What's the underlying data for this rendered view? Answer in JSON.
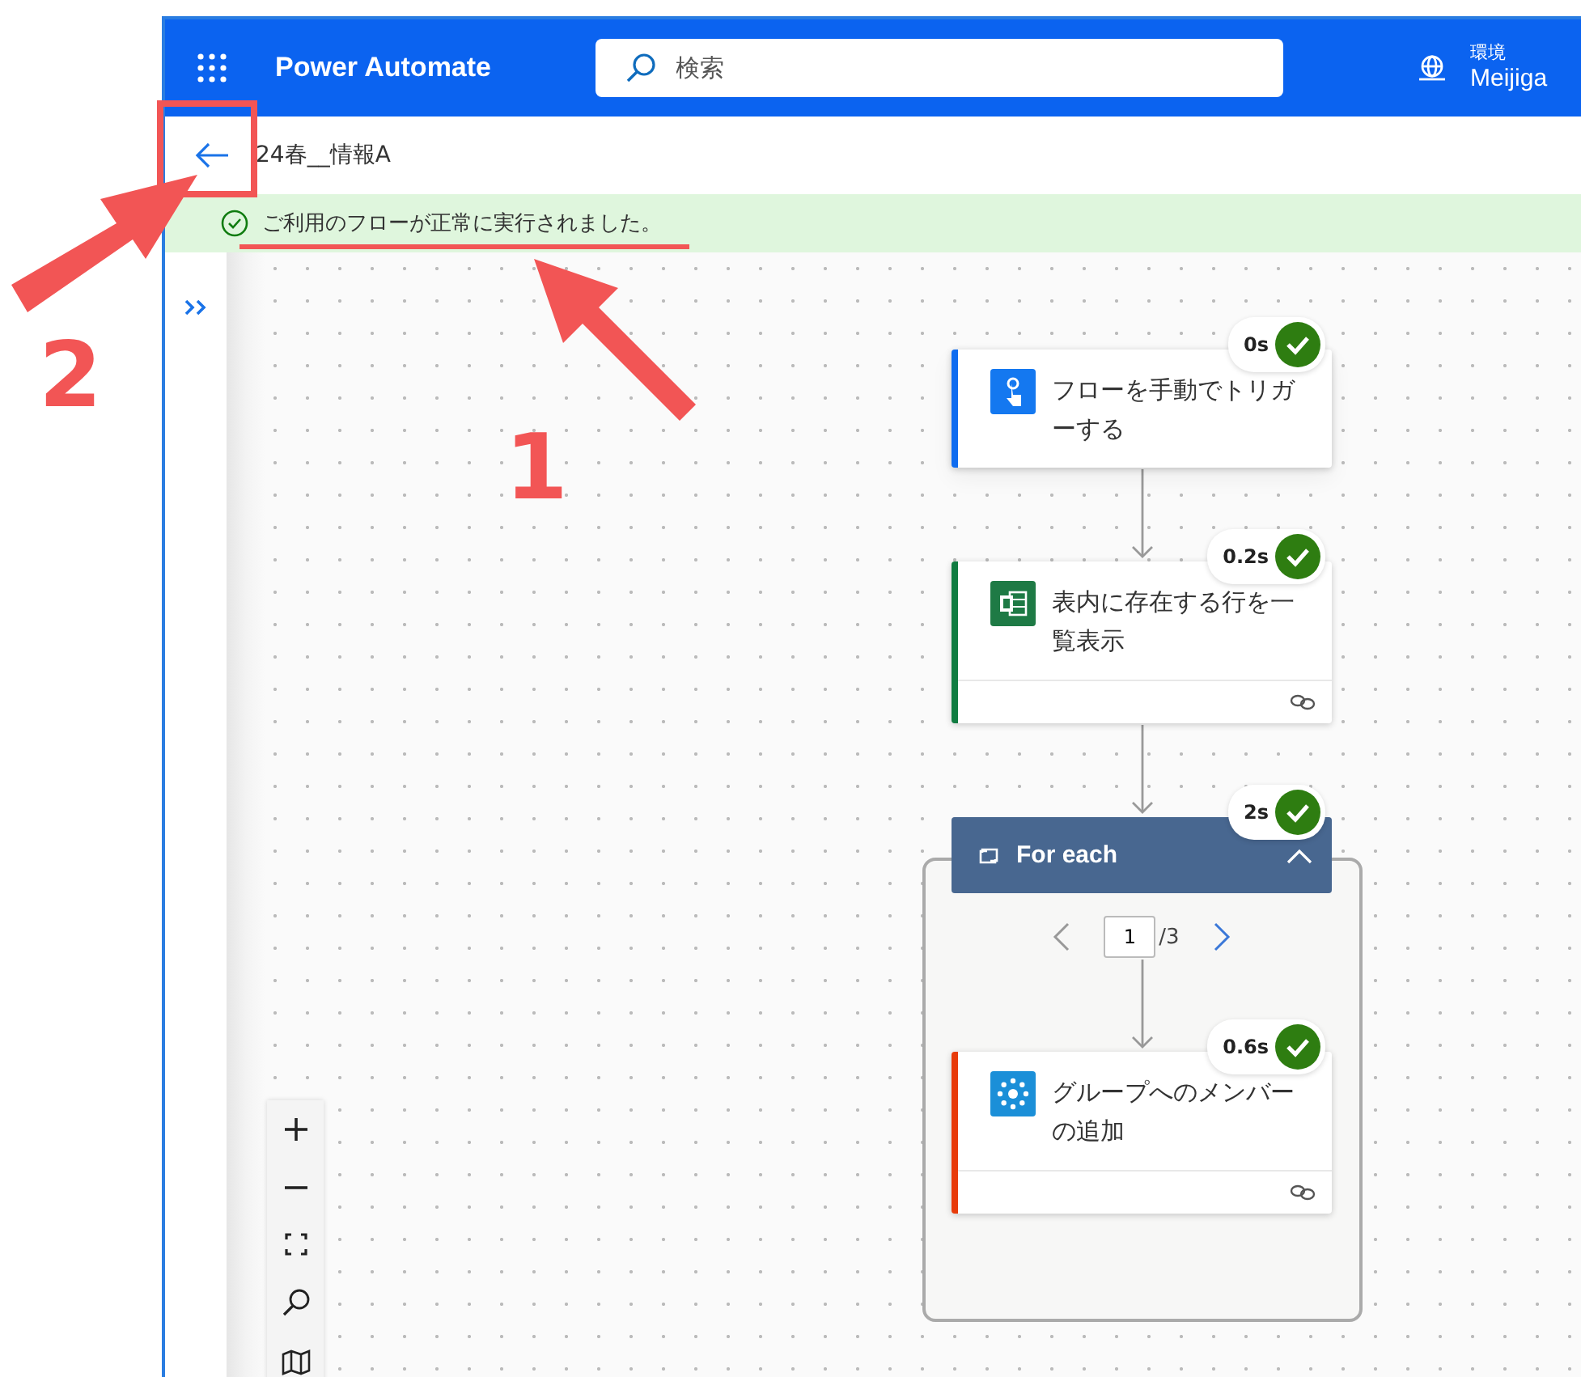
{
  "header": {
    "app_name": "Power Automate",
    "search": {
      "placeholder": "検索"
    },
    "environment": {
      "label": "環境",
      "value": "Meijiga"
    }
  },
  "flow": {
    "title": "24春__情報A"
  },
  "banner": {
    "message": "ご利用のフローが正常に実行されました。"
  },
  "nodes": [
    {
      "kind": "trigger",
      "title": "フローを手動でトリガーする",
      "duration": "0s",
      "color": "#0f6cf0"
    },
    {
      "kind": "excel",
      "title": "表内に存在する行を一覧表示",
      "duration": "0.2s",
      "color": "#107c41"
    },
    {
      "kind": "loop",
      "title": "For each",
      "duration": "2s",
      "expanded": true,
      "pager": {
        "current": "1",
        "total": "/3"
      },
      "children": [
        {
          "kind": "groups",
          "title": "グループへのメンバーの追加",
          "duration": "0.6s",
          "color": "#e83b0a"
        }
      ]
    }
  ],
  "annotations": [
    {
      "label": "1"
    },
    {
      "label": "2"
    }
  ]
}
